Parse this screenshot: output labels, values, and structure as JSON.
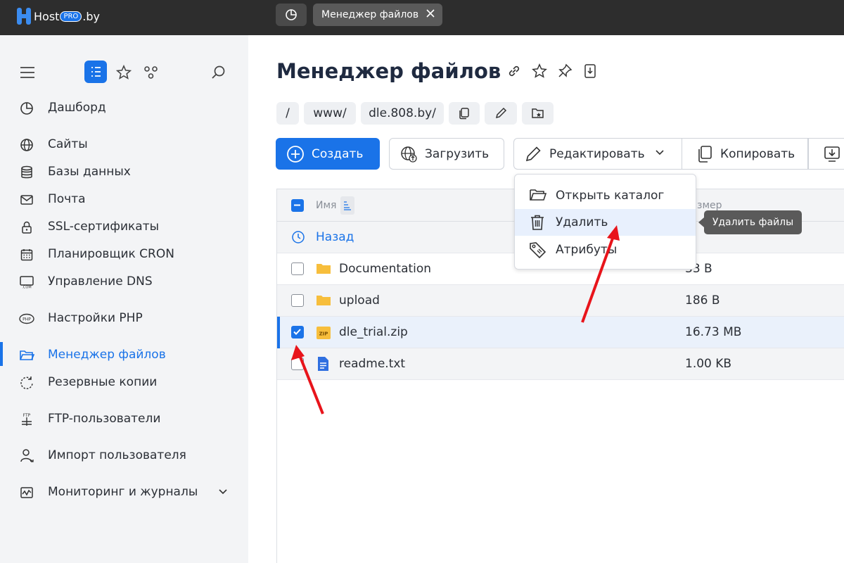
{
  "topbar": {
    "logo": {
      "host": "Host",
      "pro": "PRO",
      "tld": ".by"
    },
    "tab_label": "Менеджер файлов"
  },
  "sidebar": {
    "items": [
      {
        "label": "Дашборд",
        "icon": "pie-chart-icon"
      },
      {
        "label": "Сайты",
        "icon": "globe-icon"
      },
      {
        "label": "Базы данных",
        "icon": "database-icon"
      },
      {
        "label": "Почта",
        "icon": "mail-icon"
      },
      {
        "label": "SSL-сертификаты",
        "icon": "lock-icon"
      },
      {
        "label": "Планировщик CRON",
        "icon": "calendar-icon"
      },
      {
        "label": "Управление DNS",
        "icon": "dns-icon"
      },
      {
        "label": "Настройки PHP",
        "icon": "php-icon"
      },
      {
        "label": "Менеджер файлов",
        "icon": "folder-icon",
        "active": true
      },
      {
        "label": "Резервные копии",
        "icon": "backup-icon"
      },
      {
        "label": "FTP-пользователи",
        "icon": "ftp-icon"
      },
      {
        "label": "Импорт пользователя",
        "icon": "user-import-icon"
      },
      {
        "label": "Мониторинг и журналы",
        "icon": "monitoring-icon"
      }
    ]
  },
  "main": {
    "title": "Менеджер файлов",
    "breadcrumbs": [
      "/",
      "www/",
      "dle.808.by/"
    ],
    "toolbar": {
      "create": "Создать",
      "upload": "Загрузить",
      "edit": "Редактировать",
      "copy": "Копировать"
    },
    "table": {
      "col_name": "Имя",
      "col_size": "Размер",
      "back": "Назад",
      "rows": [
        {
          "name": "Documentation",
          "size": "33 B",
          "type": "folder",
          "checked": false
        },
        {
          "name": "upload",
          "size": "186 B",
          "type": "folder",
          "checked": false
        },
        {
          "name": "dle_trial.zip",
          "size": "16.73 MB",
          "type": "zip",
          "checked": true
        },
        {
          "name": "readme.txt",
          "size": "1.00 KB",
          "type": "text",
          "checked": false
        }
      ]
    },
    "dropdown": {
      "items": [
        "Открыть каталог",
        "Удалить",
        "Атрибуты"
      ]
    },
    "tooltip": "Удалить файлы",
    "zip_badge": "ZIP"
  },
  "colors": {
    "accent": "#1a73e8",
    "arrow": "#e8141b",
    "topbar": "#2d2d2d",
    "sidebar": "#f3f4f6"
  }
}
